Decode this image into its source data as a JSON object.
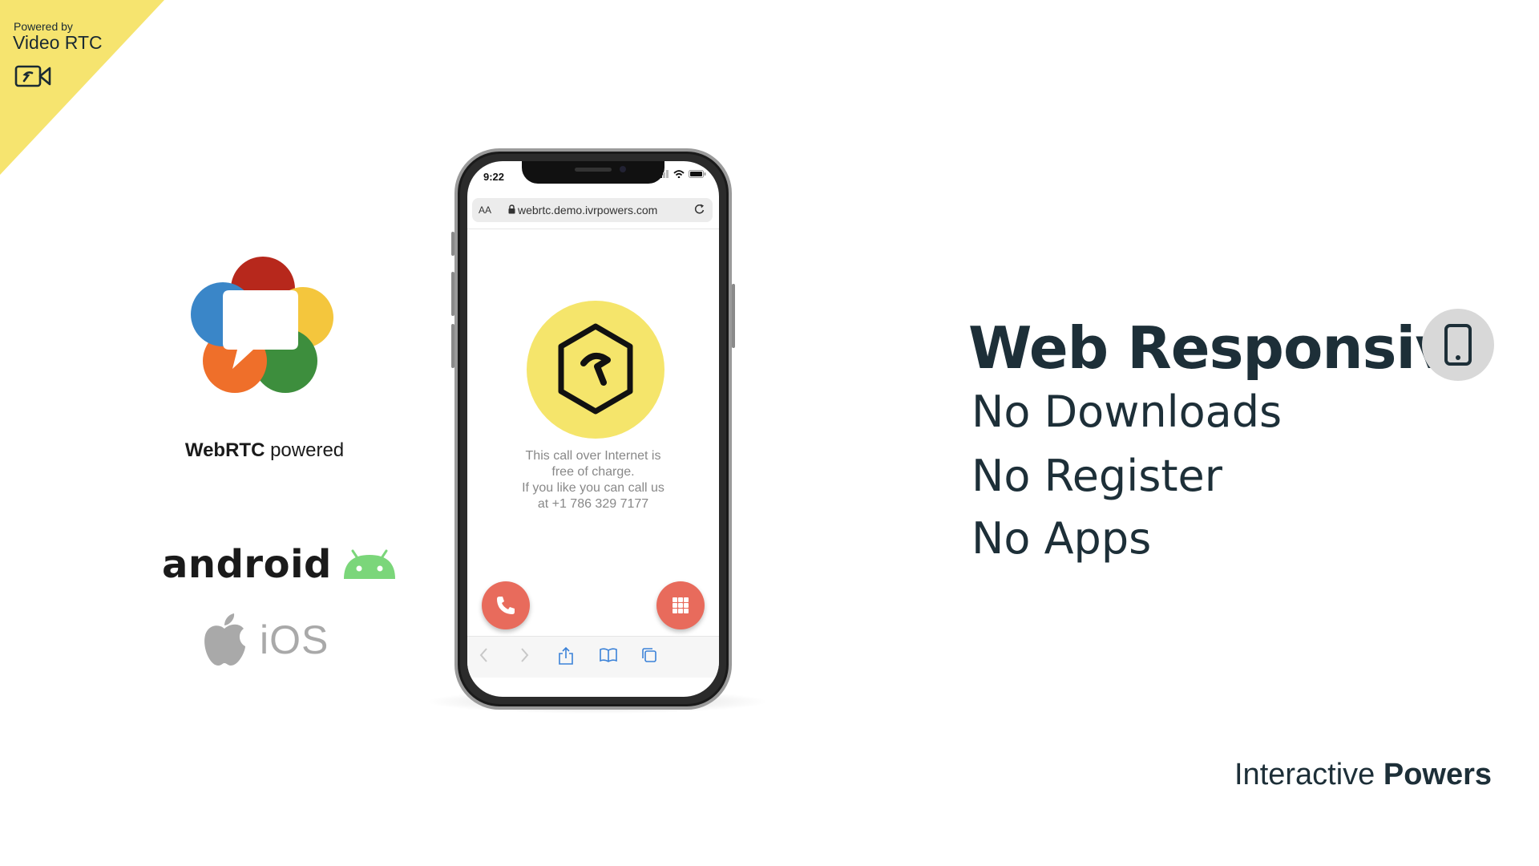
{
  "badge": {
    "powered_by": "Powered by",
    "product": "Video RTC",
    "icon": "video-camera-icon",
    "color": "#f6e46f"
  },
  "left": {
    "webrtc_bold": "WebRTC",
    "webrtc_rest": " powered",
    "android_word": "android",
    "ios_word": "iOS"
  },
  "phone": {
    "status_time": "9:22",
    "url_aa": "AA",
    "url": "webrtc.demo.ivrpowers.com",
    "call_text": [
      "This call over Internet is",
      "free of charge.",
      "If you like you can call us",
      "at +1 786 329 7177"
    ],
    "accent_yellow": "#f5e56b",
    "accent_red": "#e86b5c"
  },
  "right": {
    "headline": "Web Responsive",
    "features": [
      "No Downloads",
      "No Register",
      "No Apps"
    ]
  },
  "brand": {
    "light": "Interactive ",
    "bold": "Powers"
  }
}
